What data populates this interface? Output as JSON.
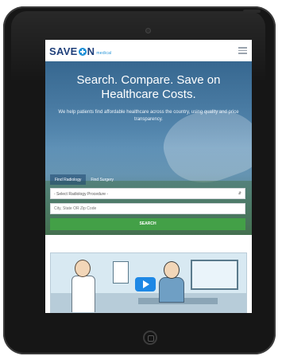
{
  "header": {
    "logo_text_1": "SAVE",
    "logo_text_2": "N",
    "logo_sub": "medical"
  },
  "hero": {
    "title_line1": "Search. Compare. Save on",
    "title_line2": "Healthcare Costs.",
    "subtitle": "We help patients find affordable healthcare across the country, using quality and price transparency."
  },
  "search": {
    "tabs": [
      {
        "label": "Find Radiology",
        "active": true
      },
      {
        "label": "Find Surgery",
        "active": false
      }
    ],
    "procedure_select": "- Select Radiology Procedure -",
    "location_placeholder": "City, State OR Zip Code",
    "button_label": "SEARCH"
  },
  "icons": {
    "menu": "hamburger-menu-icon",
    "play": "play-icon"
  },
  "colors": {
    "brand_blue": "#1f3f7a",
    "accent_blue": "#1b8fd6",
    "search_green": "#43a047"
  }
}
